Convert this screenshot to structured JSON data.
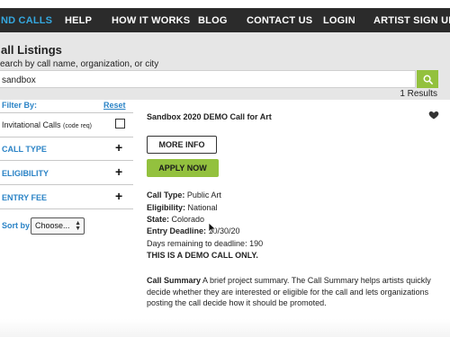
{
  "nav": {
    "items": [
      {
        "label": "ND CALLS",
        "active": true
      },
      {
        "label": "HELP"
      },
      {
        "label": "HOW IT WORKS"
      },
      {
        "label": "BLOG"
      },
      {
        "label": "CONTACT US"
      },
      {
        "label": "LOGIN"
      },
      {
        "label": "ARTIST SIGN UP"
      }
    ]
  },
  "header": {
    "title": "all Listings",
    "subtitle": "earch by call name, organization, or city"
  },
  "search": {
    "value": "sandbox",
    "icon": "search-icon"
  },
  "results_text": "1 Results",
  "sidebar": {
    "filter_by": "Filter By:",
    "reset": "Reset",
    "invitational": "Invitational Calls",
    "invitational_note": "(code req)",
    "filters": [
      {
        "label": "CALL TYPE"
      },
      {
        "label": "ELIGIBILITY"
      },
      {
        "label": "ENTRY FEE"
      }
    ],
    "sort_label": "Sort by",
    "sort_value": "Choose..."
  },
  "listing": {
    "title": "Sandbox 2020 DEMO Call for Art",
    "more_info": "MORE INFO",
    "apply_now": "APPLY NOW",
    "call_type_label": "Call Type:",
    "call_type": "Public Art",
    "eligibility_label": "Eligibility:",
    "eligibility": "National",
    "state_label": "State:",
    "state": "Colorado",
    "deadline_label": "Entry Deadline:",
    "deadline": "10/30/20",
    "days_remaining": "Days remaining to deadline: 190",
    "demo_notice": "THIS IS A DEMO CALL ONLY.",
    "summary_label": "Call Summary",
    "summary": "A brief project summary. The Call Summary helps artists quickly decide whether they are interested or eligible for the call and lets organizations posting the call decide how it should be promoted."
  },
  "colors": {
    "nav_bg": "#2b2b2b",
    "accent_blue": "#35a8e0",
    "link_blue": "#2a83c6",
    "green": "#93c13e",
    "band_bg": "#e6e6e6"
  }
}
